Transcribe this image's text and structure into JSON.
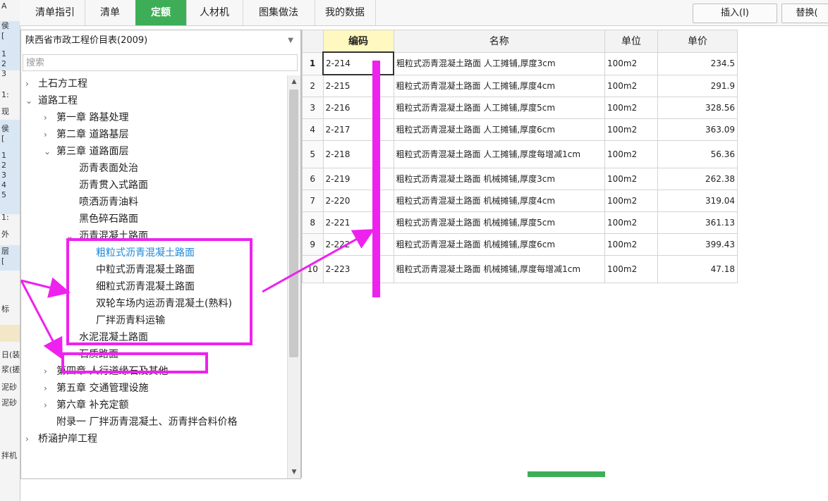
{
  "left_strip": {
    "texts": [
      "A",
      "侯",
      "[",
      "1",
      "2",
      "3",
      "1:",
      "现",
      "侯",
      "[",
      "1",
      "2",
      "3",
      "4",
      "5",
      "1:",
      "外",
      "层",
      "[",
      "标",
      "日(装",
      "浆(搓",
      "泥砂",
      "泥砂",
      "拌机"
    ]
  },
  "tabs": [
    "清单指引",
    "清单",
    "定额",
    "人材机",
    "图集做法",
    "我的数据"
  ],
  "active_tab": "定额",
  "toolbar": {
    "insert": "插入(I)",
    "replace": "替换("
  },
  "tree_panel": {
    "combo_value": "陕西省市政工程价目表(2009)",
    "search_placeholder": "搜索",
    "nodes": [
      {
        "label": "土石方工程",
        "chev": "›",
        "level": 0
      },
      {
        "label": "道路工程",
        "chev": "⌄",
        "level": 0
      },
      {
        "label": "第一章 路基处理",
        "chev": "›",
        "level": 1
      },
      {
        "label": "第二章 道路基层",
        "chev": "›",
        "level": 1
      },
      {
        "label": "第三章 道路面层",
        "chev": "⌄",
        "level": 1
      },
      {
        "label": "沥青表面处治",
        "chev": "",
        "level": 2
      },
      {
        "label": "沥青贯入式路面",
        "chev": "",
        "level": 2
      },
      {
        "label": "喷洒沥青油料",
        "chev": "",
        "level": 2
      },
      {
        "label": "黑色碎石路面",
        "chev": "",
        "level": 2
      },
      {
        "label": "沥青混凝土路面",
        "chev": "⌄",
        "level": 2
      },
      {
        "label": "粗粒式沥青混凝土路面",
        "chev": "",
        "level": 3,
        "selected": true
      },
      {
        "label": "中粒式沥青混凝土路面",
        "chev": "",
        "level": 3
      },
      {
        "label": "细粒式沥青混凝土路面",
        "chev": "",
        "level": 3
      },
      {
        "label": "双轮车场内运沥青混凝土(熟料)",
        "chev": "",
        "level": 3
      },
      {
        "label": "厂拌沥青料运输",
        "chev": "",
        "level": 3
      },
      {
        "label": "水泥混凝土路面",
        "chev": "›",
        "level": 2
      },
      {
        "label": "石质路面",
        "chev": "",
        "level": 2
      },
      {
        "label": "第四章 人行道缘石及其他",
        "chev": "›",
        "level": 1
      },
      {
        "label": "第五章 交通管理设施",
        "chev": "›",
        "level": 1
      },
      {
        "label": "第六章 补充定额",
        "chev": "›",
        "level": 1
      },
      {
        "label": "附录一 厂拌沥青混凝土、沥青拌合料价格",
        "chev": "",
        "level": 1
      },
      {
        "label": "桥涵护岸工程",
        "chev": "›",
        "level": 0
      }
    ]
  },
  "grid": {
    "headers": {
      "code": "编码",
      "name": "名称",
      "unit": "单位",
      "price": "单价"
    },
    "rows": [
      {
        "n": "1",
        "code": "2-214",
        "name": "粗粒式沥青混凝土路面 人工摊铺,厚度3cm",
        "unit": "100m2",
        "price": "234.5"
      },
      {
        "n": "2",
        "code": "2-215",
        "name": "粗粒式沥青混凝土路面 人工摊铺,厚度4cm",
        "unit": "100m2",
        "price": "291.9"
      },
      {
        "n": "3",
        "code": "2-216",
        "name": "粗粒式沥青混凝土路面 人工摊铺,厚度5cm",
        "unit": "100m2",
        "price": "328.56"
      },
      {
        "n": "4",
        "code": "2-217",
        "name": "粗粒式沥青混凝土路面 人工摊铺,厚度6cm",
        "unit": "100m2",
        "price": "363.09"
      },
      {
        "n": "5",
        "code": "2-218",
        "name": "粗粒式沥青混凝土路面 人工摊铺,厚度每增减1cm",
        "unit": "100m2",
        "price": "56.36"
      },
      {
        "n": "6",
        "code": "2-219",
        "name": "粗粒式沥青混凝土路面 机械摊铺,厚度3cm",
        "unit": "100m2",
        "price": "262.38"
      },
      {
        "n": "7",
        "code": "2-220",
        "name": "粗粒式沥青混凝土路面 机械摊铺,厚度4cm",
        "unit": "100m2",
        "price": "319.04"
      },
      {
        "n": "8",
        "code": "2-221",
        "name": "粗粒式沥青混凝土路面 机械摊铺,厚度5cm",
        "unit": "100m2",
        "price": "361.13"
      },
      {
        "n": "9",
        "code": "2-222",
        "name": "粗粒式沥青混凝土路面 机械摊铺,厚度6cm",
        "unit": "100m2",
        "price": "399.43"
      },
      {
        "n": "10",
        "code": "2-223",
        "name": "粗粒式沥青混凝土路面 机械摊铺,厚度每增减1cm",
        "unit": "100m2",
        "price": "47.18"
      }
    ]
  },
  "annotation_color": "#ee22ee",
  "accent_color": "#3dae57"
}
